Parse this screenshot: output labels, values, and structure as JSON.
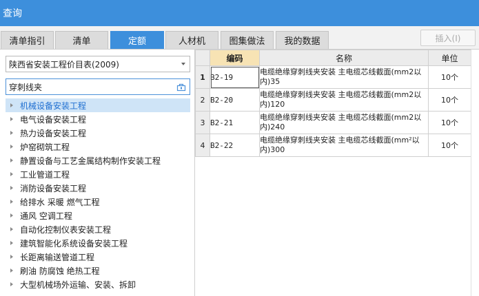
{
  "window": {
    "title": "查询"
  },
  "tabs": [
    {
      "label": "清单指引",
      "active": false
    },
    {
      "label": "清单",
      "active": false
    },
    {
      "label": "定额",
      "active": true
    },
    {
      "label": "人材机",
      "active": false
    },
    {
      "label": "图集做法",
      "active": false
    },
    {
      "label": "我的数据",
      "active": false
    }
  ],
  "toolbar": {
    "insert_label": "插入(I)"
  },
  "filter": {
    "selected": "陕西省安装工程价目表(2009)",
    "search_value": "穿刺线夹"
  },
  "tree": [
    {
      "label": "机械设备安装工程",
      "selected": true
    },
    {
      "label": "电气设备安装工程"
    },
    {
      "label": "热力设备安装工程"
    },
    {
      "label": "炉窑砌筑工程"
    },
    {
      "label": "静置设备与工艺金属结构制作安装工程"
    },
    {
      "label": "工业管道工程"
    },
    {
      "label": "消防设备安装工程"
    },
    {
      "label": "给排水 采暖 燃气工程"
    },
    {
      "label": "通风 空调工程"
    },
    {
      "label": "自动化控制仪表安装工程"
    },
    {
      "label": "建筑智能化系统设备安装工程"
    },
    {
      "label": "长距离输送管道工程"
    },
    {
      "label": "刷油 防腐蚀 绝热工程"
    },
    {
      "label": "大型机械场外运输、安装、拆卸"
    }
  ],
  "grid": {
    "columns": {
      "code": "编码",
      "name": "名称",
      "unit": "单位"
    },
    "rows": [
      {
        "num": "1",
        "code": "B2-19",
        "name": "电缆绝缘穿刺线夹安装 主电缆芯线截面(mm2以内)35",
        "unit": "10个"
      },
      {
        "num": "2",
        "code": "B2-20",
        "name": "电缆绝缘穿刺线夹安装 主电缆芯线截面(mm2以内)120",
        "unit": "10个"
      },
      {
        "num": "3",
        "code": "B2-21",
        "name": "电缆绝缘穿刺线夹安装 主电缆芯线截面(mm2以内)240",
        "unit": "10个"
      },
      {
        "num": "4",
        "code": "B2-22",
        "name": "电缆绝缘穿刺线夹安装 主电缆芯线截面(mm²以内)300",
        "unit": "10个"
      }
    ]
  }
}
